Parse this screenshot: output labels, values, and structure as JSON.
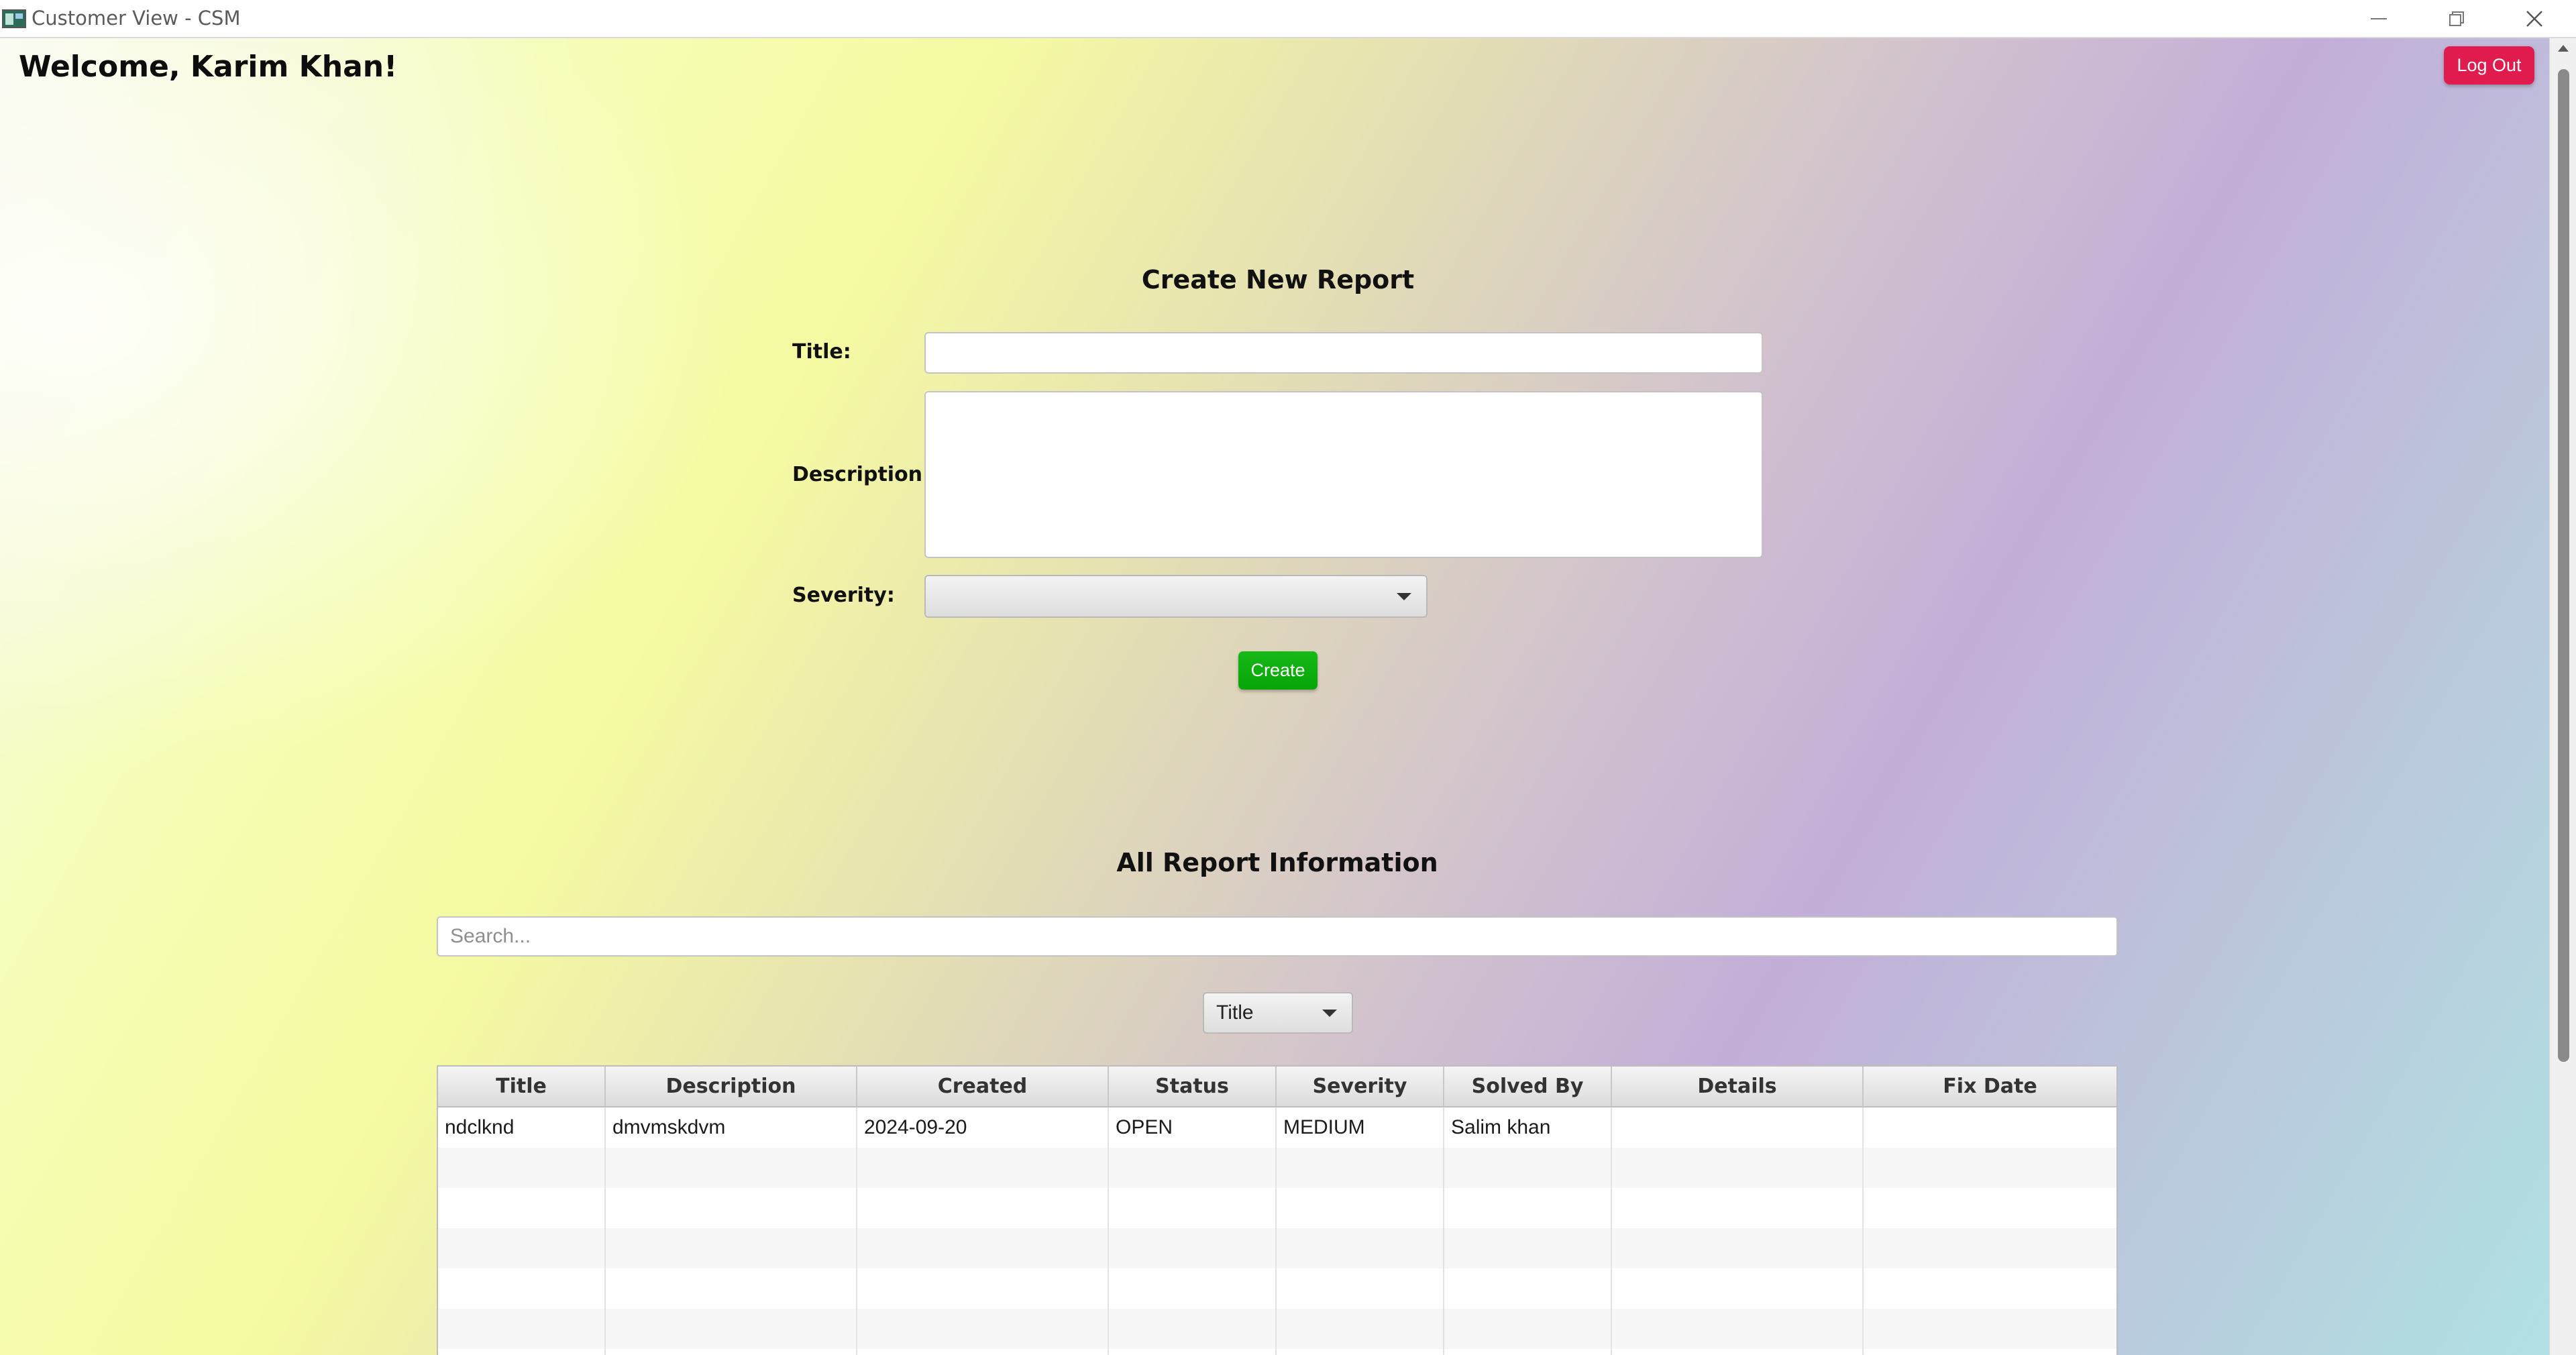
{
  "window": {
    "title": "Customer View - CSM",
    "controls": [
      "minimize-icon",
      "restore-icon",
      "close-icon"
    ]
  },
  "header": {
    "welcome": "Welcome, Karim Khan!",
    "logout_label": "Log Out"
  },
  "create_form": {
    "heading": "Create New Report",
    "title_label": "Title:",
    "title_value": "",
    "description_label": "Description:",
    "description_value": "",
    "severity_label": "Severity:",
    "severity_value": "",
    "create_label": "Create"
  },
  "reports": {
    "heading": "All Report Information",
    "search_placeholder": "Search...",
    "search_value": "",
    "filter_value": "Title",
    "columns": [
      "Title",
      "Description",
      "Created",
      "Status",
      "Severity",
      "Solved By",
      "Details",
      "Fix Date"
    ],
    "rows": [
      [
        "ndclknd",
        "dmvmskdvm",
        "2024-09-20",
        "OPEN",
        "MEDIUM",
        "Salim khan",
        "",
        ""
      ]
    ]
  },
  "colors": {
    "logout": "#e01b4d",
    "create": "#0aa80a"
  }
}
